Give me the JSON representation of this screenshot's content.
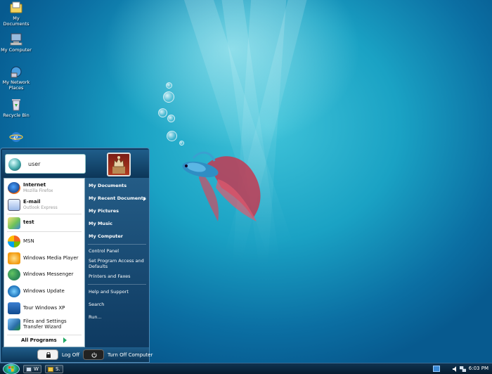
{
  "desktop": {
    "icons": [
      {
        "label": "My Documents",
        "icon": "my-documents-icon"
      },
      {
        "label": "My Computer",
        "icon": "my-computer-icon"
      },
      {
        "label": "My Network Places",
        "icon": "my-network-places-icon"
      },
      {
        "label": "Recycle Bin",
        "icon": "recycle-bin-icon"
      },
      {
        "label": "",
        "icon": "internet-explorer-icon"
      }
    ]
  },
  "start_menu": {
    "user_name": "user",
    "pinned": [
      {
        "title": "Internet",
        "subtitle": "Mozilla Firefox",
        "icon": "firefox-icon"
      },
      {
        "title": "E-mail",
        "subtitle": "Outlook Express",
        "icon": "outlook-express-icon"
      }
    ],
    "recent": [
      {
        "label": "test",
        "icon": "paint-icon"
      },
      {
        "label": "MSN",
        "icon": "msn-icon"
      },
      {
        "label": "Windows Media Player",
        "icon": "media-player-icon"
      },
      {
        "label": "Windows Messenger",
        "icon": "messenger-icon"
      },
      {
        "label": "Windows Update",
        "icon": "windows-update-icon"
      },
      {
        "label": "Tour Windows XP",
        "icon": "tour-icon"
      },
      {
        "label": "Files and Settings Transfer Wizard",
        "icon": "transfer-wizard-icon"
      }
    ],
    "all_programs": "All Programs",
    "right_items": {
      "my_documents": "My Documents",
      "my_recent_documents": "My Recent Documents",
      "my_pictures": "My Pictures",
      "my_music": "My Music",
      "my_computer": "My Computer",
      "control_panel": "Control Panel",
      "set_program_access": "Set Program Access and Defaults",
      "printers_faxes": "Printers and Faxes",
      "help_support": "Help and Support",
      "search": "Search",
      "run": "Run..."
    },
    "log_off": "Log Off",
    "turn_off": "Turn Off Computer"
  },
  "taskbar": {
    "buttons": [
      {
        "label": "W",
        "icon": "window-icon"
      },
      {
        "label": "S.",
        "icon": "folder-icon"
      }
    ],
    "clock": "6:03 PM"
  }
}
